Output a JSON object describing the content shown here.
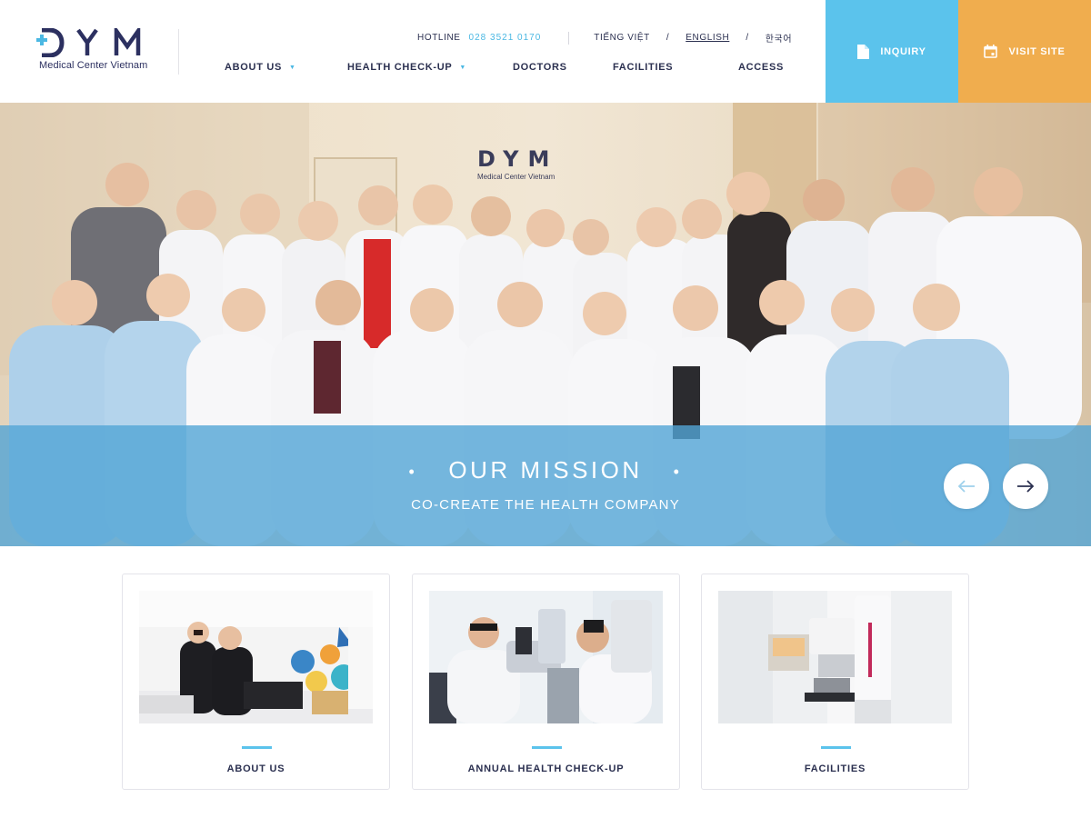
{
  "brand": {
    "logo_text": "DYM",
    "logo_subtitle": "Medical Center Vietnam",
    "accent_color": "#5bc3ec",
    "secondary_color": "#f0ad4e",
    "text_color": "#2b3050"
  },
  "topbar": {
    "hotline_label": "HOTLINE",
    "hotline_number": "028 3521 0170",
    "languages": [
      {
        "label": "TIẾNG VIỆT",
        "active": false
      },
      {
        "label": "ENGLISH",
        "active": true
      },
      {
        "label": "한국어",
        "active": false
      }
    ],
    "separator": "/"
  },
  "nav": {
    "items": [
      {
        "label": "ABOUT US",
        "has_dropdown": true
      },
      {
        "label": "HEALTH CHECK-UP",
        "has_dropdown": true
      },
      {
        "label": "DOCTORS",
        "has_dropdown": false
      },
      {
        "label": "FACILITIES",
        "has_dropdown": false
      },
      {
        "label": "ACCESS",
        "has_dropdown": false
      }
    ],
    "caret": "▼"
  },
  "cta": {
    "inquiry_label": "INQUIRY",
    "inquiry_icon": "document-icon",
    "visit_label": "VISIT SITE",
    "visit_icon": "calendar-icon"
  },
  "hero": {
    "wall_logo": "DYM",
    "wall_logo_subtitle": "Medical Center Vietnam",
    "title": "OUR MISSION",
    "title_dot": "•",
    "subtitle": "CO-CREATE THE HEALTH COMPANY",
    "prev_icon": "arrow-left-icon",
    "next_icon": "arrow-right-icon"
  },
  "cards": [
    {
      "label": "ABOUT US",
      "image": "reception-staff-photo"
    },
    {
      "label": "ANNUAL HEALTH CHECK-UP",
      "image": "eye-exam-photo"
    },
    {
      "label": "FACILITIES",
      "image": "mammography-machine-photo"
    }
  ]
}
